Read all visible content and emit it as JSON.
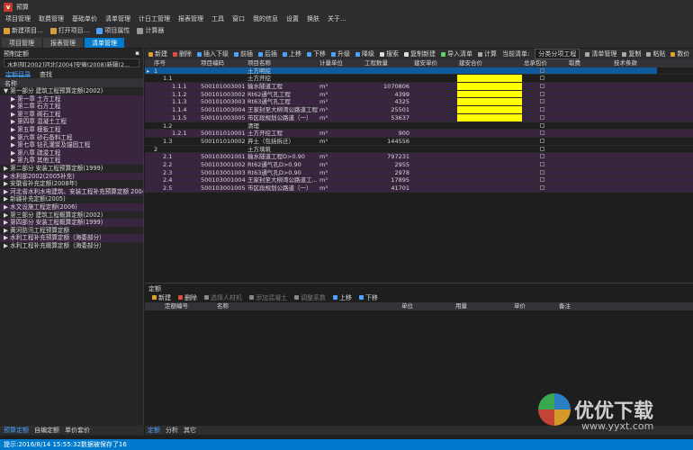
{
  "title": "预算",
  "logo": "v",
  "menu": [
    "项目管理",
    "取费管理",
    "基础单价",
    "清单管理",
    "计日工管理",
    "报表管理",
    "工具",
    "窗口",
    "我的信息",
    "设置",
    "换肤",
    "关于..."
  ],
  "toolbar1": [
    {
      "label": "新建项目...",
      "color": "#e0a030"
    },
    {
      "label": "打开项目...",
      "color": "#d0a040"
    },
    {
      "label": "项目属性",
      "color": "#4aa3ff"
    },
    {
      "label": "计算器",
      "color": "#999"
    }
  ],
  "tabs": [
    "项目管理",
    "报表管理",
    "清单管理"
  ],
  "left": {
    "header": "预制定额",
    "combo": "水利部[2002]河北[2004]安徽(2008)新疆(2...",
    "subtabs": [
      "定额目录",
      "查找"
    ],
    "col": "名称",
    "tree": [
      {
        "t": "▼ 第一部分 建筑工程预算定额(2002)",
        "i": 0,
        "a": false
      },
      {
        "t": "▶ 第一章 土方工程",
        "i": 1,
        "a": true
      },
      {
        "t": "▶ 第二章 石方工程",
        "i": 1,
        "a": true
      },
      {
        "t": "▶ 第三章 砌石工程",
        "i": 1,
        "a": true
      },
      {
        "t": "▶ 第四章 混凝土工程",
        "i": 1,
        "a": true
      },
      {
        "t": "▶ 第五章 模板工程",
        "i": 1,
        "a": true
      },
      {
        "t": "▶ 第六章 砂石备料工程",
        "i": 1,
        "a": true
      },
      {
        "t": "▶ 第七章 钻孔灌浆及锚固工程",
        "i": 1,
        "a": true
      },
      {
        "t": "▶ 第八章 疏浚工程",
        "i": 1,
        "a": true
      },
      {
        "t": "▶ 第九章 其他工程",
        "i": 1,
        "a": true
      },
      {
        "t": "▶ 第二部分 安装工程预算定额(1999)",
        "i": 0,
        "a": false
      },
      {
        "t": "▶ 水利部2002(2005补充)",
        "i": 0,
        "a": true
      },
      {
        "t": "▶ 安徽省补充定额(2008年)",
        "i": 0,
        "a": false
      },
      {
        "t": "▶ 河北省水利水电建筑、安装工程补充预算定额 2004",
        "i": 0,
        "a": true
      },
      {
        "t": "▶ 新疆补充定额(2005)",
        "i": 0,
        "a": false
      },
      {
        "t": "▶ 水文设施工程定额(2006)",
        "i": 0,
        "a": true
      },
      {
        "t": "▶ 第三部分 建筑工程概算定额(2002)",
        "i": 0,
        "a": false
      },
      {
        "t": "▶ 第四部分 安装工程概算定额(1999)",
        "i": 0,
        "a": true
      },
      {
        "t": "▶ 黄河防汛工程预算定额",
        "i": 0,
        "a": false
      },
      {
        "t": "▶ 水利工程补充预算定额（海委部分）",
        "i": 0,
        "a": true
      },
      {
        "t": "▶ 水利工程补充概算定额（海委部分）",
        "i": 0,
        "a": false
      }
    ],
    "foot": [
      "预算定额",
      "自编定额",
      "单价套价"
    ]
  },
  "grid": {
    "tools": [
      "新建",
      "删除",
      "插入下级",
      "前插",
      "后插",
      "上移",
      "下移",
      "升级",
      "降级",
      "搜索",
      "复制新建",
      "导入清单",
      "计算",
      "当前清单:",
      "分类分项工程",
      "清单管理",
      "复制",
      "粘贴",
      "数价"
    ],
    "headers": [
      "序号",
      "项目编码",
      "项目名称",
      "计量单位",
      "工程数量",
      "建安单价",
      "建安合价",
      "总承包价",
      "取费",
      "技术条款"
    ],
    "rows": [
      {
        "no": "1",
        "code": "",
        "name": "土方明挖",
        "unit": "",
        "qty": "",
        "sel": true,
        "hl": false,
        "y": false
      },
      {
        "no": "1.1",
        "code": "",
        "name": "土方开挖",
        "unit": "",
        "qty": "",
        "sel": false,
        "hl": false,
        "y": true
      },
      {
        "no": "1.1.1",
        "code": "500101003001",
        "name": "输水隧道工程",
        "unit": "m³",
        "qty": "1070806",
        "sel": false,
        "hl": true,
        "y": true
      },
      {
        "no": "1.1.2",
        "code": "500101003002",
        "name": "Rt62通气孔工程",
        "unit": "m³",
        "qty": "4399",
        "sel": false,
        "hl": true,
        "y": true
      },
      {
        "no": "1.1.3",
        "code": "500101003003",
        "name": "Rt63通气孔工程",
        "unit": "m³",
        "qty": "4325",
        "sel": false,
        "hl": true,
        "y": true
      },
      {
        "no": "1.1.4",
        "code": "500101003004",
        "name": "王家封至大柳湾公路道工程",
        "unit": "m³",
        "qty": "25501",
        "sel": false,
        "hl": true,
        "y": true
      },
      {
        "no": "1.1.5",
        "code": "500101003005",
        "name": "市区段规划公路道（一）",
        "unit": "m³",
        "qty": "53637",
        "sel": false,
        "hl": true,
        "y": true
      },
      {
        "no": "1.2",
        "code": "",
        "name": "清理",
        "unit": "",
        "qty": "",
        "sel": false,
        "hl": false,
        "y": false
      },
      {
        "no": "1.2.1",
        "code": "500101010001",
        "name": "土方开挖工程",
        "unit": "m³",
        "qty": "900",
        "sel": false,
        "hl": true,
        "y": false
      },
      {
        "no": "1.3",
        "code": "500101010002",
        "name": "弃土（包括拆迁）",
        "unit": "m³",
        "qty": "144556",
        "sel": false,
        "hl": false,
        "y": false
      },
      {
        "no": "2",
        "code": "",
        "name": "土方填筑",
        "unit": "",
        "qty": "",
        "sel": false,
        "hl": false,
        "y": false
      },
      {
        "no": "2.1",
        "code": "500103001001",
        "name": "输水隧道工程D>0.90",
        "unit": "m³",
        "qty": "797231",
        "sel": false,
        "hl": true,
        "y": false
      },
      {
        "no": "2.2",
        "code": "500103001002",
        "name": "Rt62通气孔D>0.90",
        "unit": "m³",
        "qty": "2955",
        "sel": false,
        "hl": true,
        "y": false
      },
      {
        "no": "2.3",
        "code": "500103001003",
        "name": "Rt63通气孔D>0.90",
        "unit": "m³",
        "qty": "2978",
        "sel": false,
        "hl": true,
        "y": false
      },
      {
        "no": "2.4",
        "code": "500103001004",
        "name": "王家封至大柳湾公路道工...",
        "unit": "m³",
        "qty": "17895",
        "sel": false,
        "hl": true,
        "y": false
      },
      {
        "no": "2.5",
        "code": "500103001005",
        "name": "市区段规划公路道（一）",
        "unit": "m³",
        "qty": "41701",
        "sel": false,
        "hl": true,
        "y": false
      }
    ]
  },
  "bottom": {
    "title": "定额",
    "tools": [
      "新建",
      "删除",
      "选择人材机",
      "添加混凝土",
      "调整系数",
      "上移",
      "下移"
    ],
    "headers": [
      "定额编号",
      "名称",
      "单位",
      "用量",
      "单价",
      "备注"
    ],
    "tabs": [
      "定额",
      "分析",
      "其它"
    ]
  },
  "status": "提示:2016/8/14 15:55:32数据被保存了16",
  "watermark": {
    "text": "优优下载",
    "url": "www.yyxt.com"
  }
}
